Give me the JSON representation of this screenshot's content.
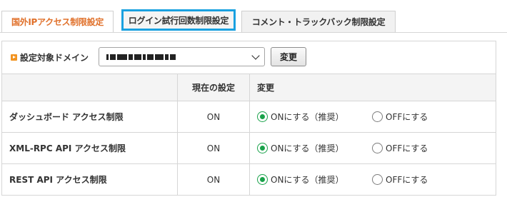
{
  "tabs": [
    {
      "label": "国外IPアクセス制限設定",
      "state": "active"
    },
    {
      "label": "ログイン試行回数制限設定",
      "state": "highlighted"
    },
    {
      "label": "コメント・トラックバック制限設定",
      "state": "normal"
    }
  ],
  "domain": {
    "label": "設定対象ドメイン",
    "selected_value": "",
    "button_label": "変更"
  },
  "table": {
    "headers": [
      "",
      "現在の設定",
      "変更"
    ],
    "rows": [
      {
        "name": "ダッシュボード アクセス制限",
        "status": "ON",
        "option_on": "ONにする（推奨）",
        "option_off": "OFFにする",
        "selected": "on"
      },
      {
        "name": "XML-RPC API アクセス制限",
        "status": "ON",
        "option_on": "ONにする（推奨）",
        "option_off": "OFFにする",
        "selected": "on"
      },
      {
        "name": "REST API アクセス制限",
        "status": "ON",
        "option_on": "ONにする（推奨）",
        "option_off": "OFFにする",
        "selected": "on"
      }
    ]
  },
  "colors": {
    "active_tab_text": "#e0702a",
    "highlight_border": "#1aa1e0",
    "radio_checked": "#19a24a",
    "bullet": "#f29422"
  }
}
